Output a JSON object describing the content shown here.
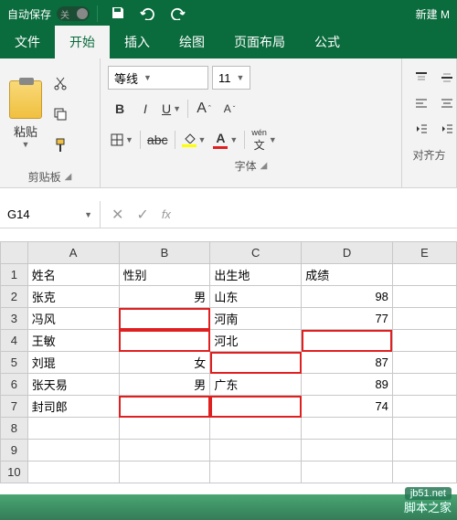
{
  "titlebar": {
    "autosave_label": "自动保存",
    "autosave_state": "关",
    "filename": "新建 M"
  },
  "tabs": {
    "file": "文件",
    "home": "开始",
    "insert": "插入",
    "draw": "绘图",
    "layout": "页面布局",
    "formula": "公式"
  },
  "ribbon": {
    "paste_label": "粘贴",
    "clipboard_group": "剪贴板",
    "font_group": "字体",
    "align_group": "对齐方",
    "font_name": "等线",
    "font_size": "11",
    "phonetic": "wén",
    "bold": "B",
    "italic": "I",
    "underline": "U",
    "aa_grow": "A",
    "aa_shrink": "A",
    "abc": "abc",
    "font_color_A": "A"
  },
  "namebox": {
    "ref": "G14",
    "fx": "fx"
  },
  "columns": [
    "A",
    "B",
    "C",
    "D",
    "E"
  ],
  "rows": [
    "1",
    "2",
    "3",
    "4",
    "5",
    "6",
    "7",
    "8",
    "9",
    "10"
  ],
  "cells": {
    "headers": {
      "A": "姓名",
      "B": "性别",
      "C": "出生地",
      "D": "成绩"
    },
    "r2": {
      "A": "张克",
      "B": "男",
      "C": "山东",
      "D": "98"
    },
    "r3": {
      "A": "冯风",
      "B": "",
      "C": "河南",
      "D": "77"
    },
    "r4": {
      "A": "王敏",
      "B": "",
      "C": "河北",
      "D": ""
    },
    "r5": {
      "A": "刘琨",
      "B": "女",
      "C": "",
      "D": "87"
    },
    "r6": {
      "A": "张天易",
      "B": "男",
      "C": "广东",
      "D": "89"
    },
    "r7": {
      "A": "封司郎",
      "B": "",
      "C": "",
      "D": "74"
    }
  },
  "watermark": {
    "url": "jb51.net",
    "text": "脚本之家"
  }
}
